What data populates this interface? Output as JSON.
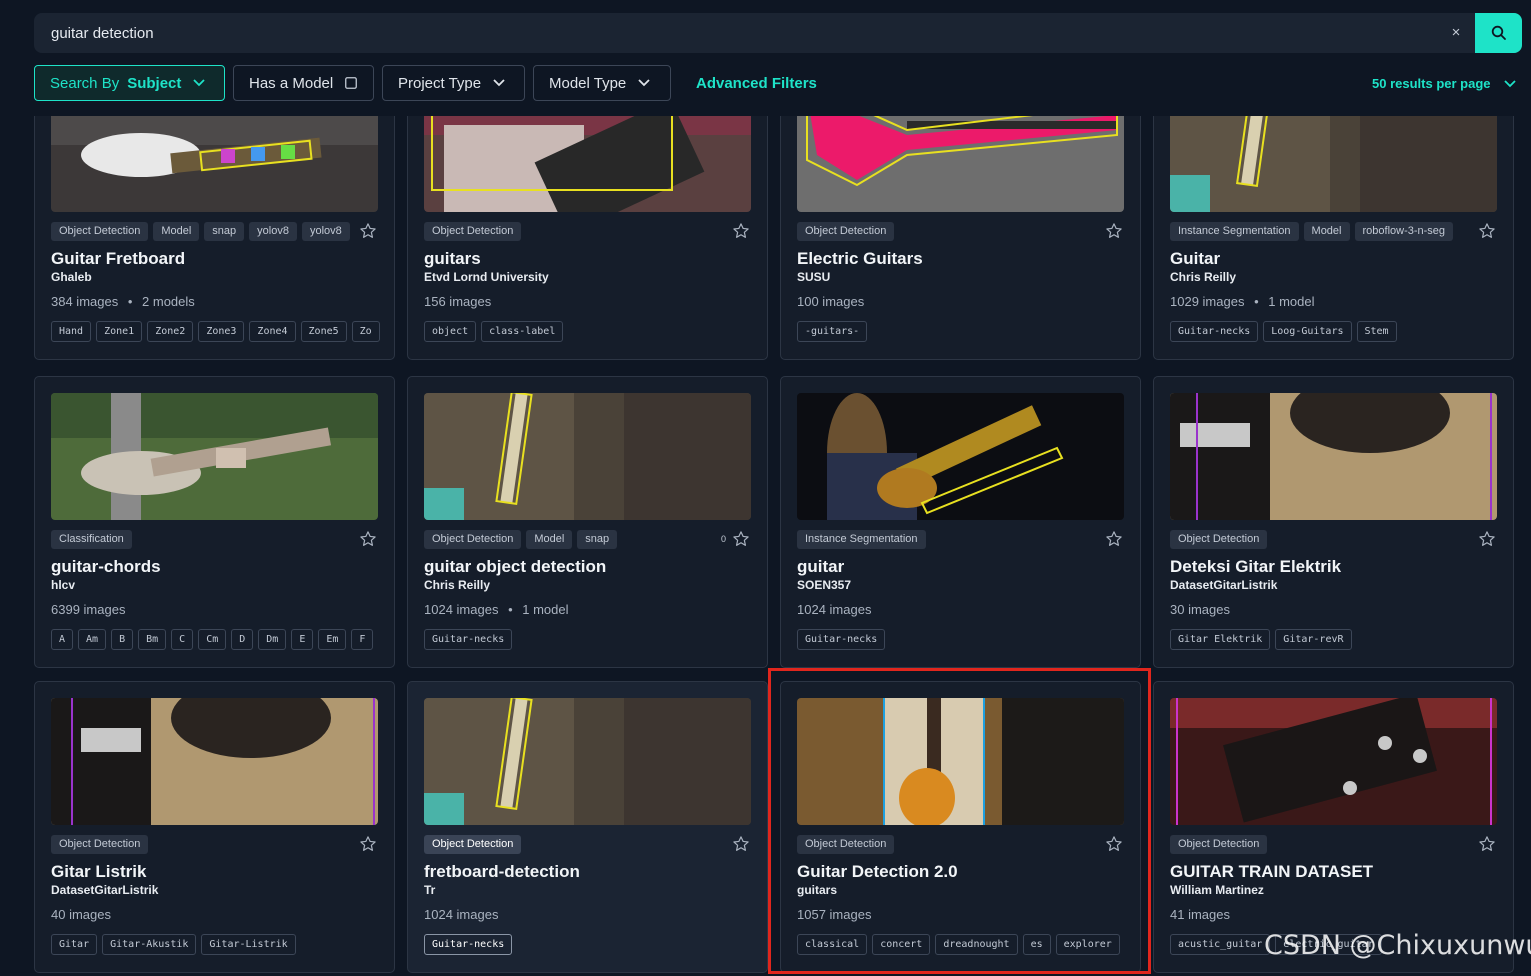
{
  "search": {
    "value": "guitar detection",
    "clear_label": "×"
  },
  "filters": {
    "search_by_label": "Search By",
    "search_by_value": "Subject",
    "has_model_label": "Has a Model",
    "project_type_label": "Project Type",
    "model_type_label": "Model Type",
    "advanced_label": "Advanced Filters",
    "per_page_label": "50 results per page"
  },
  "colors": {
    "accent": "#1ee3c8",
    "highlight": "#e0261d",
    "card_bg": "#151d2a"
  },
  "cards": [
    {
      "badges": [
        "Object Detection",
        "Model",
        "snap",
        "yolov8",
        "yolov8"
      ],
      "title": "Guitar Fretboard",
      "owner": "Ghaleb",
      "images": "384 images",
      "models": "2 models",
      "classes": [
        "Hand",
        "Zone1",
        "Zone2",
        "Zone3",
        "Zone4",
        "Zone5",
        "Zo"
      ]
    },
    {
      "badges": [
        "Object Detection"
      ],
      "title": "guitars",
      "owner": "Etvd Lornd University",
      "images": "156 images",
      "models": "",
      "classes": [
        "object",
        "class-label"
      ]
    },
    {
      "badges": [
        "Object Detection"
      ],
      "title": "Electric Guitars",
      "owner": "SUSU",
      "images": "100 images",
      "models": "",
      "classes": [
        "-guitars-"
      ]
    },
    {
      "badges": [
        "Instance Segmentation",
        "Model",
        "roboflow-3-n-seg"
      ],
      "title": "Guitar",
      "owner": "Chris Reilly",
      "images": "1029 images",
      "models": "1 model",
      "classes": [
        "Guitar-necks",
        "Loog-Guitars",
        "Stem"
      ]
    },
    {
      "badges": [
        "Classification"
      ],
      "title": "guitar-chords",
      "owner": "hlcv",
      "images": "6399 images",
      "models": "",
      "classes": [
        "A",
        "Am",
        "B",
        "Bm",
        "C",
        "Cm",
        "D",
        "Dm",
        "E",
        "Em",
        "F"
      ]
    },
    {
      "badges": [
        "Object Detection",
        "Model",
        "snap"
      ],
      "extra": "0",
      "title": "guitar object detection",
      "owner": "Chris Reilly",
      "images": "1024 images",
      "models": "1 model",
      "classes": [
        "Guitar-necks"
      ]
    },
    {
      "badges": [
        "Instance Segmentation"
      ],
      "title": "guitar",
      "owner": "SOEN357",
      "images": "1024 images",
      "models": "",
      "classes": [
        "Guitar-necks"
      ]
    },
    {
      "badges": [
        "Object Detection"
      ],
      "title": "Deteksi Gitar Elektrik",
      "owner": "DatasetGitarListrik",
      "images": "30 images",
      "models": "",
      "classes": [
        "Gitar Elektrik",
        "Gitar-revR"
      ]
    },
    {
      "badges": [
        "Object Detection"
      ],
      "title": "Gitar Listrik",
      "owner": "DatasetGitarListrik",
      "images": "40 images",
      "models": "",
      "classes": [
        "Gitar",
        "Gitar-Akustik",
        "Gitar-Listrik"
      ]
    },
    {
      "badges": [
        "Object Detection"
      ],
      "title": "fretboard-detection",
      "owner": "Tr",
      "images": "1024 images",
      "models": "",
      "classes": [
        "Guitar-necks"
      ]
    },
    {
      "badges": [
        "Object Detection"
      ],
      "title": "Guitar Detection 2.0",
      "owner": "guitars",
      "images": "1057 images",
      "models": "",
      "classes": [
        "classical",
        "concert",
        "dreadnought",
        "es",
        "explorer"
      ]
    },
    {
      "badges": [
        "Object Detection"
      ],
      "title": "GUITAR TRAIN DATASET",
      "owner": "William Martinez",
      "images": "41 images",
      "models": "",
      "classes": [
        "acustic_guitar",
        "electric_guitar"
      ]
    }
  ],
  "watermark": "CSDN @Chixuxunwu"
}
